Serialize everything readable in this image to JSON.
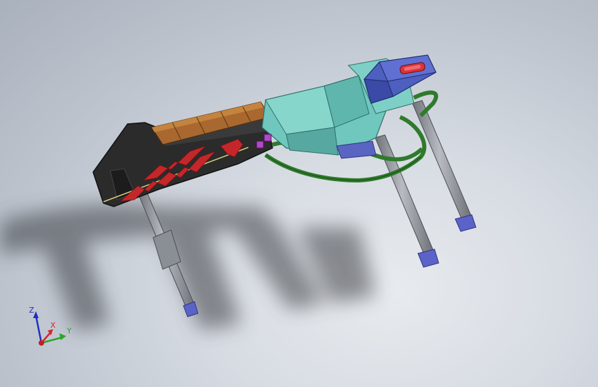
{
  "triad": {
    "z_label": "Z",
    "x_label": "X",
    "y_label": "Y"
  },
  "colors": {
    "background_center": "#e8ebef",
    "background_edge": "#a9b1bc",
    "stand_body": "#2b2b2b",
    "zigzag": "#c4272a",
    "wood_grip": "#a8682f",
    "teal_body": "#6fc7bd",
    "purple_block": "#4d5fbf",
    "red_handle": "#d8343a",
    "green_strap": "#2f7a2b",
    "leg_metal": "#8f939a",
    "leg_tip": "#5b63c9",
    "axis_x": "#d9252b",
    "axis_y": "#2aa52a",
    "axis_z": "#1f2fbf"
  }
}
